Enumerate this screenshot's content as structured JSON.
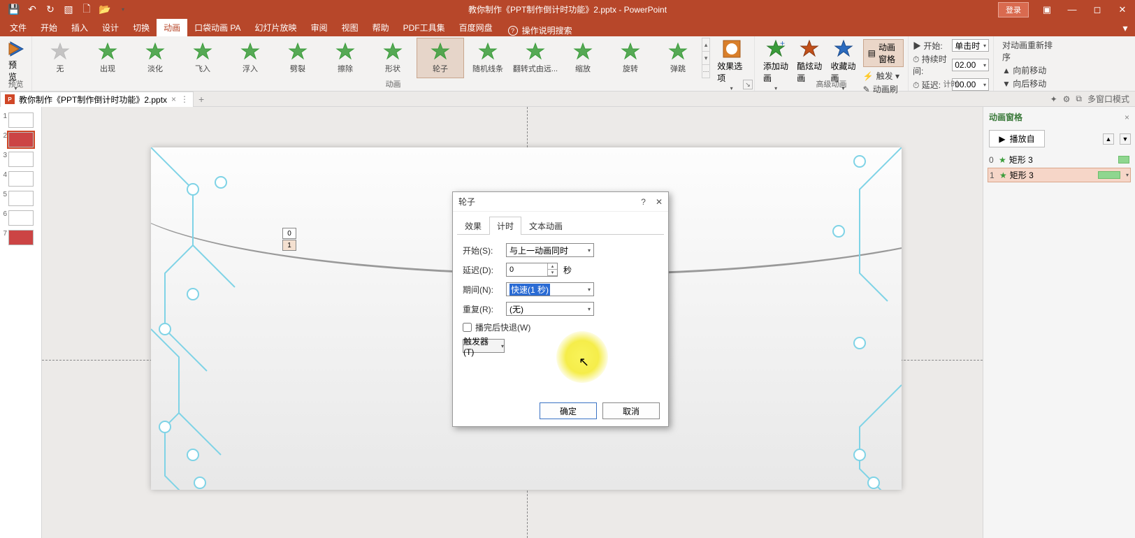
{
  "titlebar": {
    "app_title": "教你制作《PPT制作倒计时功能》2.pptx - PowerPoint",
    "login": "登录"
  },
  "menu": {
    "tabs": [
      "文件",
      "开始",
      "插入",
      "设计",
      "切换",
      "动画",
      "口袋动画 PA",
      "幻灯片放映",
      "审阅",
      "视图",
      "帮助",
      "PDF工具集",
      "百度网盘"
    ],
    "active": 5,
    "search_placeholder": "操作说明搜索"
  },
  "ribbon": {
    "preview": {
      "label": "预览",
      "group": "预览"
    },
    "animations": [
      "无",
      "出现",
      "淡化",
      "飞入",
      "浮入",
      "劈裂",
      "擦除",
      "形状",
      "轮子",
      "随机线条",
      "翻转式由远...",
      "缩放",
      "旋转",
      "弹跳"
    ],
    "anim_selected": 8,
    "anim_group": "动画",
    "effect_options": "效果选项",
    "adv": {
      "add": "添加动画",
      "cool": "酷炫动画",
      "fav": "收藏动画",
      "trigger": "触发 ▾",
      "painter": "动画刷",
      "pane": "动画窗格",
      "group": "高级动画"
    },
    "timing": {
      "start_label": "▶ 开始:",
      "start_value": "单击时",
      "duration_label": "⏱ 持续时间:",
      "duration_value": "02.00",
      "delay_label": "⏱ 延迟:",
      "delay_value": "00.00",
      "group": "计时"
    },
    "reorder": {
      "title": "对动画重新排序",
      "fwd": "▲ 向前移动",
      "back": "▼ 向后移动"
    }
  },
  "doctab": {
    "name": "教你制作《PPT制作倒计时功能》2.pptx",
    "multiwin": "多窗口模式"
  },
  "thumbs": {
    "count": 7,
    "selected": 2
  },
  "slide": {
    "counter0": "0",
    "counter1": "1"
  },
  "anim_pane": {
    "title": "动画窗格",
    "play": "播放自",
    "items": [
      {
        "idx": "0",
        "name": "矩形 3"
      },
      {
        "idx": "1",
        "name": "矩形 3"
      }
    ],
    "selected": 1
  },
  "dialog": {
    "title": "轮子",
    "tabs": [
      "效果",
      "计时",
      "文本动画"
    ],
    "active_tab": 1,
    "start_label": "开始(S):",
    "start_value": "与上一动画同时",
    "delay_label": "延迟(D):",
    "delay_value": "0",
    "delay_unit": "秒",
    "duration_label": "期间(N):",
    "duration_value": "快速(1 秒)",
    "repeat_label": "重复(R):",
    "repeat_value": "(无)",
    "rewind": "播完后快退(W)",
    "trigger": "触发器(T)",
    "ok": "确定",
    "cancel": "取消"
  }
}
